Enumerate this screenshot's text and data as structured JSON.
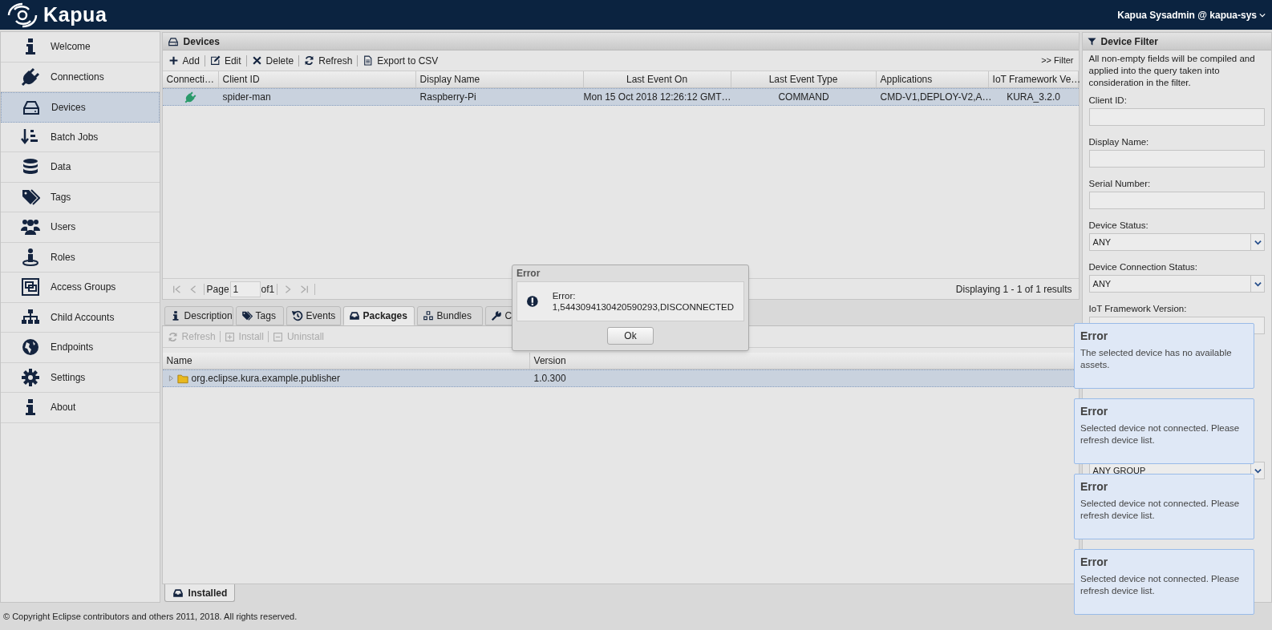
{
  "header": {
    "logo": "Kapua",
    "user": "Kapua Sysadmin @ kapua-sys"
  },
  "sidebar": {
    "items": [
      {
        "label": "Welcome",
        "selected": false
      },
      {
        "label": "Connections",
        "selected": false
      },
      {
        "label": "Devices",
        "selected": true
      },
      {
        "label": "Batch Jobs",
        "selected": false
      },
      {
        "label": "Data",
        "selected": false
      },
      {
        "label": "Tags",
        "selected": false
      },
      {
        "label": "Users",
        "selected": false
      },
      {
        "label": "Roles",
        "selected": false
      },
      {
        "label": "Access Groups",
        "selected": false
      },
      {
        "label": "Child Accounts",
        "selected": false
      },
      {
        "label": "Endpoints",
        "selected": false
      },
      {
        "label": "Settings",
        "selected": false
      },
      {
        "label": "About",
        "selected": false
      }
    ]
  },
  "devices_panel": {
    "title": "Devices",
    "toolbar": [
      {
        "label": "Add"
      },
      {
        "label": "Edit"
      },
      {
        "label": "Delete"
      },
      {
        "label": "Refresh"
      },
      {
        "label": "Export to CSV"
      }
    ],
    "filter_toggle": ">> Filter",
    "table": {
      "columns": [
        "Connecti…",
        "Client ID",
        "Display Name",
        "Last Event On",
        "Last Event Type",
        "Applications",
        "IoT Framework Ve…"
      ],
      "rows": [
        {
          "connected": true,
          "selected": true,
          "cells": [
            "",
            "spider-man",
            "Raspberry-Pi",
            "Mon 15 Oct 2018 12:26:12 GMT…",
            "COMMAND",
            "CMD-V1,DEPLOY-V2,A…",
            "KURA_3.2.0"
          ]
        }
      ]
    },
    "pager": {
      "page_label": "Page",
      "page": "1",
      "of_label": "of1",
      "summary": "Displaying 1 - 1 of 1 results"
    }
  },
  "detail_tabs": [
    {
      "label": "Description",
      "selected": false
    },
    {
      "label": "Tags",
      "selected": false
    },
    {
      "label": "Events",
      "selected": false
    },
    {
      "label": "Packages",
      "selected": true
    },
    {
      "label": "Bundles",
      "selected": false
    },
    {
      "label": "C",
      "selected": false
    }
  ],
  "packages": {
    "toolbar": [
      {
        "label": "Refresh",
        "disabled": true
      },
      {
        "label": "Install",
        "disabled": true
      },
      {
        "label": "Uninstall",
        "disabled": true
      }
    ],
    "columns": [
      "Name",
      "Version"
    ],
    "rows": [
      {
        "name": "org.eclipse.kura.example.publisher",
        "version": "1.0.300",
        "expanded": false,
        "selected": true
      }
    ],
    "bottom_tabs": [
      {
        "label": "Installed",
        "selected": true
      }
    ]
  },
  "footer": "© Copyright Eclipse contributors and others 2011, 2018. All rights reserved.",
  "filter": {
    "title": "Device Filter",
    "description": "All non-empty fields will be compiled and applied into the query taken into consideration in the filter.",
    "fields": [
      {
        "kind": "text",
        "label": "Client ID:"
      },
      {
        "kind": "text",
        "label": "Display Name:"
      },
      {
        "kind": "text",
        "label": "Serial Number:"
      },
      {
        "kind": "select",
        "label": "Device Status:",
        "value": "ANY"
      },
      {
        "kind": "select",
        "label": "Device Connection Status:",
        "value": "ANY"
      },
      {
        "kind": "text",
        "label": "IoT Framework Version:"
      },
      {
        "kind": "select",
        "value": "ANY GROUP"
      }
    ]
  },
  "dialog": {
    "title": "Error",
    "message_label": "Error:",
    "message": "1,5443094130420590293,DISCONNECTED",
    "button": "Ok"
  },
  "notifications": [
    {
      "title": "Error",
      "message": "The selected device has no available assets."
    },
    {
      "title": "Error",
      "message": "Selected device not connected. Please refresh device list."
    },
    {
      "title": "Error",
      "message": "Selected device not connected. Please refresh device list."
    },
    {
      "title": "Error",
      "message": "Selected device not connected. Please refresh device list."
    }
  ]
}
